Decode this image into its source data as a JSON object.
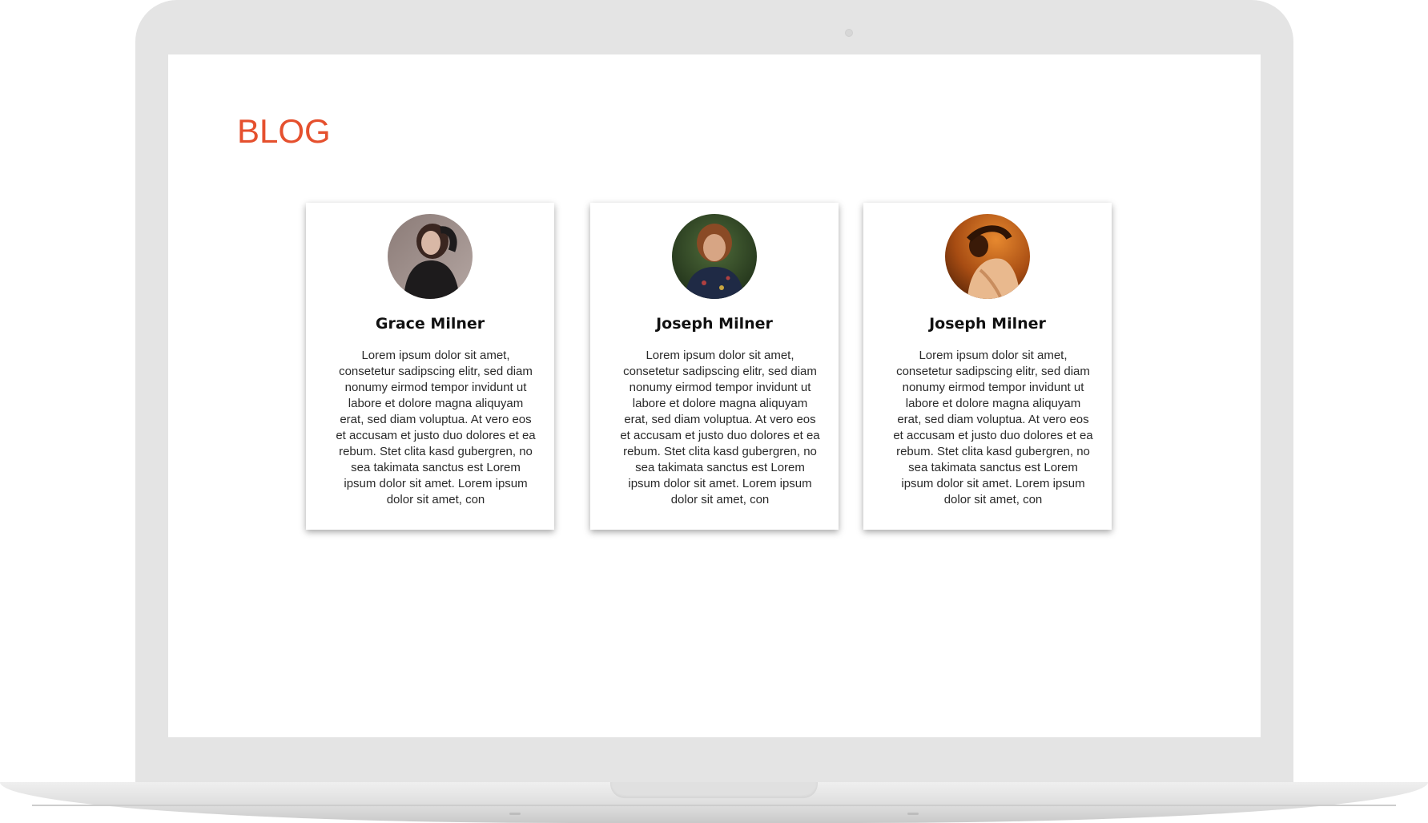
{
  "page": {
    "title": "BLOG",
    "accent_color": "#e5502e"
  },
  "cards": [
    {
      "name": "Grace Milner",
      "avatar_icon": "person-photo-icon",
      "text": "Lorem ipsum dolor sit amet, consetetur sadipscing elitr, sed diam nonumy eirmod tempor invidunt ut labore et dolore magna aliquyam erat, sed diam voluptua. At vero eos et accusam et justo duo dolores et ea rebum. Stet clita kasd gubergren, no sea takimata sanctus est Lorem ipsum dolor sit amet. Lorem ipsum dolor sit amet, con"
    },
    {
      "name": "Joseph Milner",
      "avatar_icon": "person-photo-icon",
      "text": "Lorem ipsum dolor sit amet, consetetur sadipscing elitr, sed diam nonumy eirmod tempor invidunt ut labore et dolore magna aliquyam erat, sed diam voluptua. At vero eos et accusam et justo duo dolores et ea rebum. Stet clita kasd gubergren, no sea takimata sanctus est Lorem ipsum dolor sit amet. Lorem ipsum dolor sit amet, con"
    },
    {
      "name": "Joseph Milner",
      "avatar_icon": "person-photo-icon",
      "text": "Lorem ipsum dolor sit amet, consetetur sadipscing elitr, sed diam nonumy eirmod tempor invidunt ut labore et dolore magna aliquyam erat, sed diam voluptua. At vero eos et accusam et justo duo dolores et ea rebum. Stet clita kasd gubergren, no sea takimata sanctus est Lorem ipsum dolor sit amet. Lorem ipsum dolor sit amet, con"
    }
  ]
}
